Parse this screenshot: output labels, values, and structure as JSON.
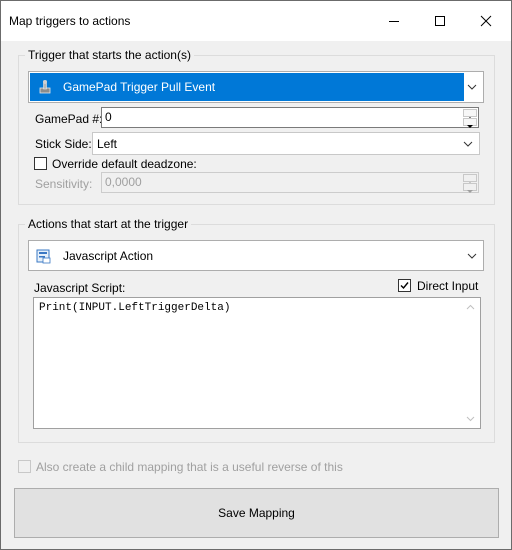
{
  "window": {
    "title": "Map triggers to actions"
  },
  "trigger_group": {
    "label": "Trigger that starts the action(s)",
    "selected_trigger": "GamePad Trigger Pull Event",
    "trigger_icon": "gamepad-icon",
    "gamepad_label": "GamePad #:",
    "gamepad_value": "0",
    "stick_side_label": "Stick Side:",
    "stick_side_value": "Left",
    "override_label": "Override default deadzone:",
    "override_checked": false,
    "sensitivity_label": "Sensitivity:",
    "sensitivity_value": "0,0000"
  },
  "actions_group": {
    "label": "Actions that start at the trigger",
    "selected_action": "Javascript Action",
    "action_icon": "javascript-icon",
    "script_label": "Javascript Script:",
    "direct_input_label": "Direct Input",
    "direct_input_checked": true,
    "script_text": "Print(INPUT.LeftTriggerDelta)"
  },
  "reverse_mapping_label": "Also create a child mapping that is a useful reverse of this",
  "save_button_label": "Save Mapping",
  "colors": {
    "selection": "#0078d7",
    "window_bg": "#f0f0f0"
  }
}
